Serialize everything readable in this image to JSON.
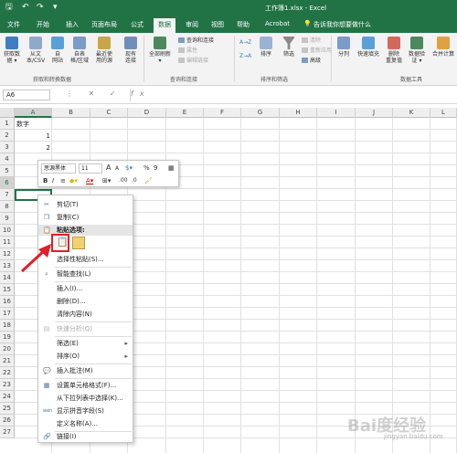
{
  "titlebar": {
    "title": "工作簿1.xlsx - Excel",
    "save_icon": "save-icon",
    "undo_icon": "undo-icon",
    "redo_icon": "redo-icon"
  },
  "tabs": [
    "文件",
    "开始",
    "插入",
    "页面布局",
    "公式",
    "数据",
    "审阅",
    "视图",
    "帮助",
    "Acrobat"
  ],
  "active_tab": "数据",
  "tell_me": "告诉我你想要做什么",
  "ribbon": {
    "get_data": "获取数\n据 ▾",
    "from_text": "从文\n本/CSV",
    "from_web": "自\n网站",
    "from_table": "自表\n格/区域",
    "recent_sources": "最近使\n用的源",
    "existing_conn": "现有\n连接",
    "refresh_all": "全部刷新\n▾",
    "queries_conn": "查询和连接",
    "properties": "属性",
    "edit_links": "编辑链接",
    "sort_asc": "A→Z",
    "sort_desc": "Z→A",
    "sort": "排序",
    "filter": "筛选",
    "clear": "清除",
    "reapply": "重新应用",
    "advanced": "高级",
    "text_to_cols": "分列",
    "flash_fill": "快速填充",
    "remove_dup": "删除\n重复值",
    "data_valid": "数据验\n证 ▾",
    "consolidate": "合并计算",
    "group_get": "获取和转换数据",
    "group_query": "查询和连接",
    "group_sort": "排序和筛选",
    "group_tools": "数据工具"
  },
  "formula_bar": {
    "name_box": "A6",
    "fx": "fx",
    "icons": "⋮ ✕ ✓"
  },
  "columns": [
    "A",
    "B",
    "C",
    "D",
    "E",
    "F",
    "G",
    "H",
    "I",
    "J",
    "K",
    "L"
  ],
  "rows": [
    "1",
    "2",
    "3",
    "4",
    "5",
    "6",
    "7",
    "8",
    "9",
    "10",
    "11",
    "12",
    "13",
    "14",
    "15",
    "16",
    "17",
    "18",
    "19",
    "20",
    "21",
    "22",
    "23",
    "24",
    "25",
    "26",
    "27"
  ],
  "cells": {
    "A1": "数字",
    "A2": "1",
    "A3": "2"
  },
  "mini_toolbar": {
    "font": "思源黑体",
    "size": "11",
    "grow": "A",
    "shrink": "A",
    "bold": "B",
    "italic": "I",
    "percent": "%",
    "comma": "9"
  },
  "context_menu": {
    "cut": "剪切(T)",
    "copy": "复制(C)",
    "paste_options": "粘贴选项:",
    "paste_special": "选择性粘贴(S)...",
    "smart_lookup": "智能查找(L)",
    "insert": "插入(I)...",
    "delete": "删除(D)...",
    "clear_contents": "清除内容(N)",
    "quick_analysis": "快速分析(Q)",
    "filter": "筛选(E)",
    "sort": "排序(O)",
    "insert_comment": "插入批注(M)",
    "format_cells": "设置单元格格式(F)...",
    "pick_list": "从下拉列表中选择(K)...",
    "phonetic": "显示拼音字段(S)",
    "define_name": "定义名称(A)...",
    "link": "链接(I)"
  },
  "watermark": {
    "text": "Bai度经验",
    "sub": "jingyan.baidu.com"
  }
}
